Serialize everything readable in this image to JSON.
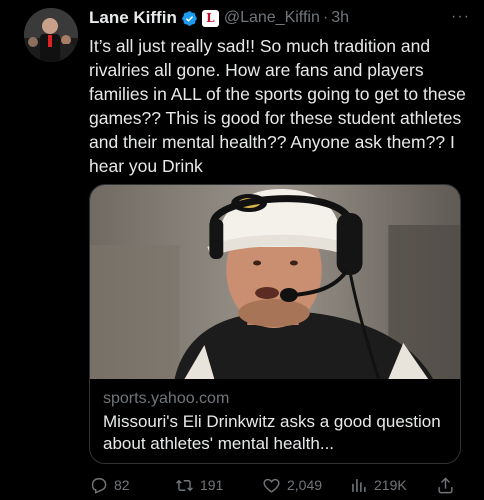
{
  "tweet": {
    "author_name": "Lane Kiffin",
    "affiliation_badge": "L",
    "handle": "@Lane_Kiffin",
    "separator": "·",
    "time": "3h",
    "more": "···",
    "text": "It’s all just really sad!! So much tradition and rivalries all gone. How are fans and players families in ALL of the sports going to get to these games?? This is good for these student athletes and their mental health?? Anyone ask them?? I hear you Drink"
  },
  "card": {
    "domain": "sports.yahoo.com",
    "title": "Missouri's Eli Drinkwitz asks a good question about athletes' mental health..."
  },
  "actions": {
    "replies": "82",
    "retweets": "191",
    "likes": "2,049",
    "views": "219K"
  },
  "colors": {
    "background": "#000000",
    "text": "#e7e9ea",
    "muted": "#71767b",
    "verified": "#1d9bf0",
    "border": "#2f3336"
  },
  "icons": {
    "verified": "verified-badge-icon",
    "reply": "reply-icon",
    "retweet": "retweet-icon",
    "like": "heart-icon",
    "views": "views-icon",
    "share": "share-icon"
  }
}
